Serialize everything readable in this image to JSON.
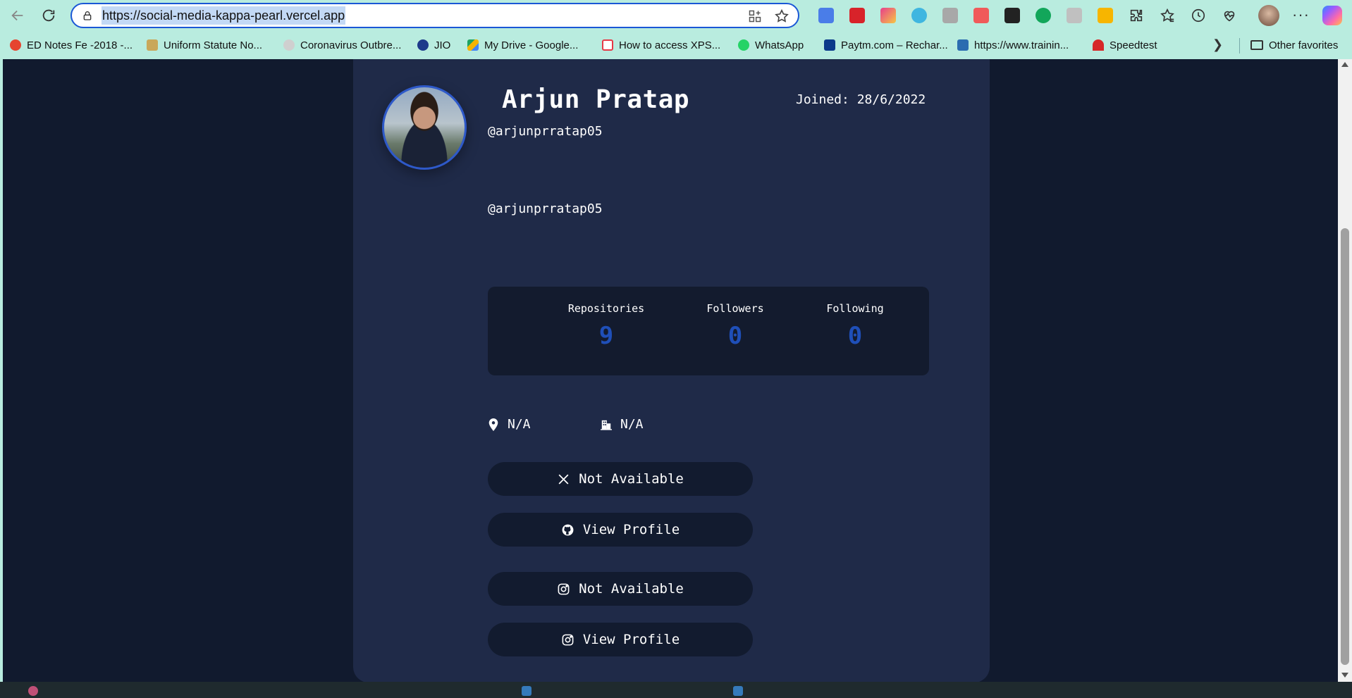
{
  "browser": {
    "url": "https://social-media-kappa-pearl.vercel.app",
    "bookmarks": [
      {
        "label": "ED Notes Fe -2018 -...",
        "color": "#e6452f"
      },
      {
        "label": "Uniform Statute No...",
        "color": "#c9a75a"
      },
      {
        "label": "Coronavirus Outbre...",
        "color": "#cfcfcf"
      },
      {
        "label": "JIO",
        "color": "#1d3a8a"
      },
      {
        "label": "My Drive - Google...",
        "color": "#f4b400"
      },
      {
        "label": "How to access XPS...",
        "color": "#e63946"
      },
      {
        "label": "WhatsApp",
        "color": "#25d366"
      },
      {
        "label": "Paytm.com – Rechar...",
        "color": "#0b3a8a"
      },
      {
        "label": "https://www.trainin...",
        "color": "#2b6cb0"
      },
      {
        "label": "Speedtest",
        "color": "#d62828"
      }
    ],
    "other_favorites": "Other favorites"
  },
  "profile": {
    "name": "Arjun Pratap",
    "joined": "Joined: 28/6/2022",
    "handle": "@arjunprratap05",
    "bio": "@arjunprratap05",
    "stats": [
      {
        "label": "Repositories",
        "value": "9"
      },
      {
        "label": "Followers",
        "value": "0"
      },
      {
        "label": "Following",
        "value": "0"
      }
    ],
    "location": "N/A",
    "company": "N/A",
    "links": {
      "twitter": "Not Available",
      "github": "View Profile",
      "instagram": "Not Available",
      "instagram_profile": "View Profile"
    }
  }
}
